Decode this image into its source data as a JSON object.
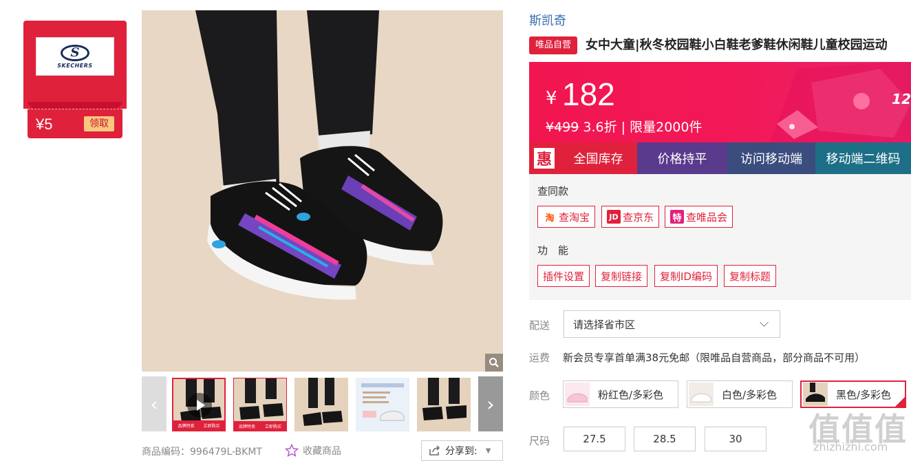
{
  "coupon": {
    "amount": "¥5",
    "action": "领取",
    "logo_text": "SKECHERS"
  },
  "gallery": {
    "thumbnail_band_left": "品牌特卖",
    "thumbnail_band_right": "立即购买"
  },
  "product_meta": {
    "sku_label": "商品编码：",
    "sku": "996479L-BKMT",
    "favorite": "收藏商品",
    "share": "分享到:"
  },
  "brand": "斯凯奇",
  "vip_tag": "唯品自营",
  "title": "女中大童|秋冬校园鞋小白鞋老爹鞋休闲鞋儿童校园运动",
  "price": {
    "currency": "¥",
    "value": "182",
    "original": "¥499",
    "discount_info": "3.6折 | 限量2000件",
    "banner_right": "12"
  },
  "toolbar": {
    "icon_char": "惠",
    "items": [
      {
        "label": "全国库存",
        "color": "#e0213c"
      },
      {
        "label": "价格持平",
        "color": "#5a3a8c"
      },
      {
        "label": "访问移动端",
        "color": "#3b4c7e"
      },
      {
        "label": "移动端二维码",
        "color": "#1d6f87"
      }
    ]
  },
  "compare": {
    "label": "查同款",
    "buttons": [
      {
        "icon": "淘",
        "label": "查淘宝"
      },
      {
        "icon": "JD",
        "label": "查京东"
      },
      {
        "icon": "特",
        "label": "查唯品会"
      }
    ]
  },
  "functions": {
    "label": "功　能",
    "buttons": [
      "插件设置",
      "复制链接",
      "复制ID编码",
      "复制标题"
    ]
  },
  "delivery": {
    "label": "配送",
    "placeholder": "请选择省市区"
  },
  "shipping": {
    "label": "运费",
    "text": "新会员专享首单满38元免邮（限唯品自营商品，部分商品不可用）"
  },
  "colors": {
    "label": "颜色",
    "options": [
      {
        "name": "粉红色/多彩色",
        "selected": false
      },
      {
        "name": "白色/多彩色",
        "selected": false
      },
      {
        "name": "黑色/多彩色",
        "selected": true
      }
    ]
  },
  "sizes": {
    "label": "尺码",
    "options": [
      "27.5",
      "28.5",
      "30"
    ]
  },
  "watermark": {
    "logo": "值值值",
    "url": "zhizhizhi.com"
  }
}
